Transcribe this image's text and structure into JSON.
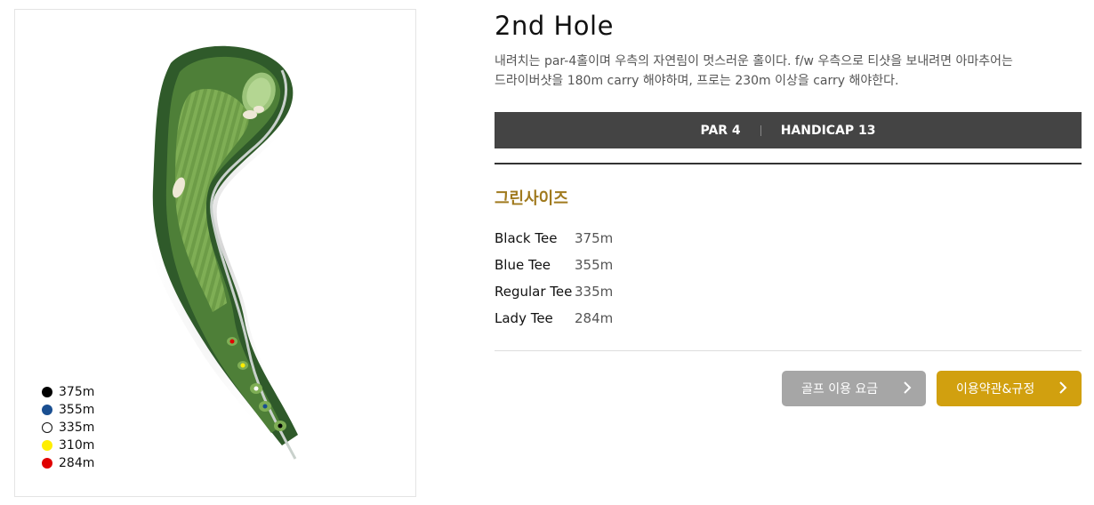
{
  "hole": {
    "title": "2nd Hole",
    "description_line1": "내려치는 par-4홀이며 우측의 자연림이 멋스러운 홀이다. f/w 우측으로 티샷을 보내려면 아마추어는",
    "description_line2": "드라이버샷을 180m carry 해야하며, 프로는 230m 이상을 carry 해야한다.",
    "par_label": "PAR 4",
    "handicap_label": "HANDICAP 13"
  },
  "green_size_title": "그린사이즈",
  "tees": [
    {
      "name": "Black Tee",
      "distance": "375m"
    },
    {
      "name": "Blue Tee",
      "distance": "355m"
    },
    {
      "name": "Regular Tee",
      "distance": "335m"
    },
    {
      "name": "Lady Tee",
      "distance": "284m"
    }
  ],
  "legend": [
    {
      "label": "375m",
      "color": "#000000"
    },
    {
      "label": "355m",
      "color": "#1a4f91"
    },
    {
      "label": "335m",
      "color": "#ffffff"
    },
    {
      "label": "310m",
      "color": "#ffee00"
    },
    {
      "label": "284m",
      "color": "#e00000"
    }
  ],
  "buttons": {
    "fee_label": "골프 이용 요금",
    "terms_label": "이용약관&규정",
    "chevron_icon": "chevron-right-icon"
  },
  "colors": {
    "par_bar": "#444444",
    "accent_gold": "#d1a00f",
    "green_title": "#a07a1e",
    "fee_button": "#a6a6a6"
  }
}
